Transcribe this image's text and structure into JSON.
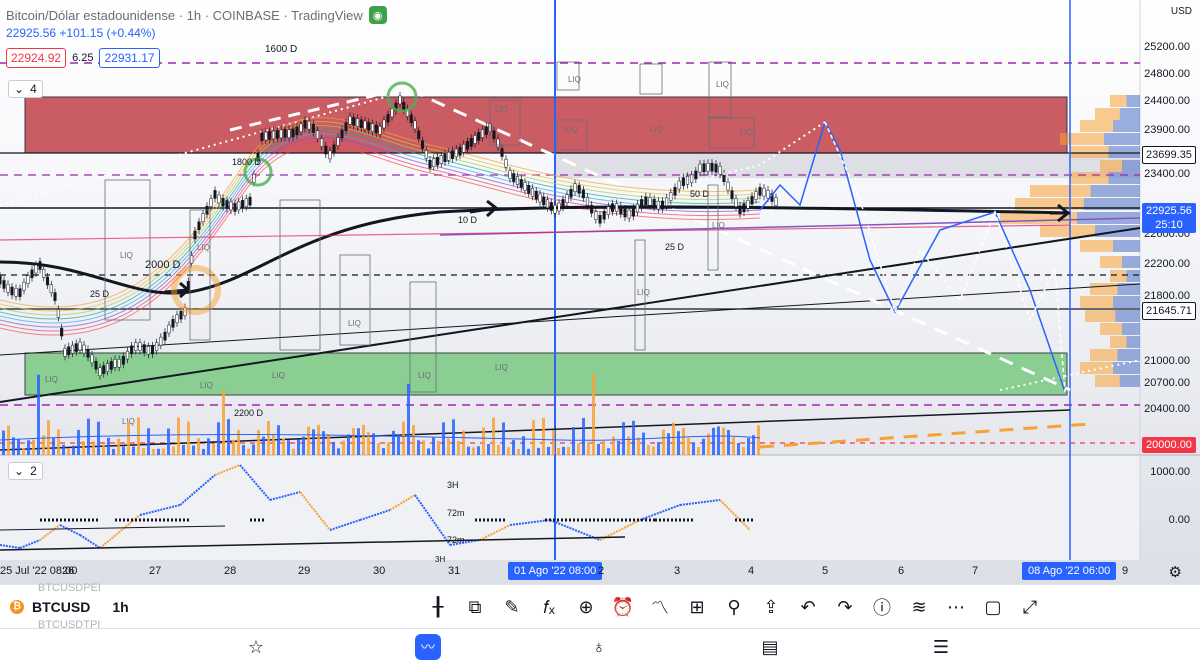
{
  "header": {
    "title": "Bitcoin/Dólar estadounidense · 1h · COINBASE · TradingView",
    "price": "22925.56",
    "change": "+101.15 (+0.44%)",
    "bid": "22924.92",
    "spread": "6.25",
    "ask": "22931.17"
  },
  "panes": {
    "main_badge": "4",
    "indicator_badge": "2"
  },
  "axis": {
    "currency": "USD",
    "price_ticks": [
      "25200.00",
      "24800.00",
      "24400.00",
      "23900.00",
      "23400.00",
      "22600.00",
      "22200.00",
      "21800.00",
      "21000.00",
      "20700.00",
      "20400.00"
    ],
    "indicator_ticks": [
      "1000.00",
      "0.00"
    ],
    "tags": [
      {
        "value": "23699.35",
        "bg": "#ffffff",
        "fg": "#131722"
      },
      {
        "value": "22925.56",
        "bg": "#2962ff",
        "fg": "#ffffff"
      },
      {
        "value": "25:10",
        "bg": "#2962ff",
        "fg": "#ffffff"
      },
      {
        "value": "21645.71",
        "bg": "#ffffff",
        "fg": "#131722"
      },
      {
        "value": "20000.00",
        "bg": "#f23645",
        "fg": "#ffffff"
      }
    ]
  },
  "time_axis": {
    "labels": [
      "25 Jul '22  08:00",
      "26",
      "27",
      "28",
      "29",
      "30",
      "31",
      "01 Ago '22  08:00",
      "2",
      "3",
      "4",
      "5",
      "6",
      "7",
      "08 Ago '22  06:00",
      "9"
    ]
  },
  "annotations": {
    "liq": "LIQ",
    "labels": [
      "1600 D",
      "1800 D",
      "2000 D",
      "2200 D",
      "25 D",
      "10 D",
      "50 D",
      "25 D",
      "3H",
      "72m",
      "72m",
      "3H"
    ]
  },
  "toolbar": {
    "symbol": "BTCUSD",
    "timeframe": "1h",
    "ghost_above": "BTCUSDPEI",
    "ghost_below": "BTCUSDTPI",
    "icons": [
      "candles-icon",
      "replay-icon",
      "draw-icon",
      "formula-icon",
      "add-icon",
      "alarm-icon",
      "indicators-icon",
      "layouts-icon",
      "ideas-icon",
      "share-icon",
      "undo-icon",
      "redo-icon",
      "info-icon",
      "compare-icon",
      "more-icon",
      "fullscreen-square-icon",
      "expand-icon"
    ]
  },
  "nav": {
    "icons": [
      "star-icon",
      "chart-icon",
      "ideas-bulb-icon",
      "news-icon",
      "menu-icon"
    ]
  },
  "colors": {
    "accent": "#2962ff",
    "red_zone": "#c2424a",
    "green_zone": "#74c77a",
    "orange": "#f7a234",
    "volume_blue": "#2962ff"
  }
}
